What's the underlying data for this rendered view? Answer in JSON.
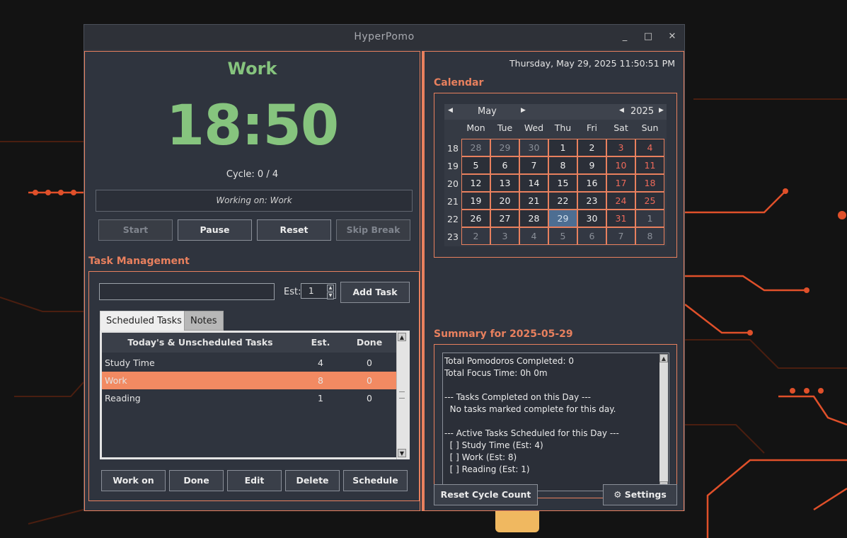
{
  "window": {
    "title": "HyperPomo"
  },
  "timer": {
    "mode": "Work",
    "time": "18:50",
    "cycle": "Cycle: 0 / 4",
    "working_on": "Working on: Work",
    "buttons": {
      "start": "Start",
      "pause": "Pause",
      "reset": "Reset",
      "skip": "Skip Break"
    }
  },
  "tasks": {
    "section_title": "Task Management",
    "input_value": "",
    "est_label": "Est:",
    "est_value": "1",
    "add_label": "Add Task",
    "tabs": [
      "Scheduled Tasks",
      "Notes"
    ],
    "columns": [
      "Today's & Unscheduled Tasks",
      "Est.",
      "Done"
    ],
    "rows": [
      {
        "name": "Study Time",
        "est": "4",
        "done": "0"
      },
      {
        "name": "Work",
        "est": "8",
        "done": "0"
      },
      {
        "name": "Reading",
        "est": "1",
        "done": "0"
      }
    ],
    "actions": {
      "work_on": "Work on",
      "done": "Done",
      "edit": "Edit",
      "delete": "Delete",
      "schedule": "Schedule"
    }
  },
  "datetime": "Thursday, May 29, 2025  11:50:51 PM",
  "calendar": {
    "title": "Calendar",
    "month": "May",
    "year": "2025",
    "dow": [
      "Mon",
      "Tue",
      "Wed",
      "Thu",
      "Fri",
      "Sat",
      "Sun"
    ],
    "weeks": [
      {
        "num": "18",
        "days": [
          "28",
          "29",
          "30",
          "1",
          "2",
          "3",
          "4"
        ]
      },
      {
        "num": "19",
        "days": [
          "5",
          "6",
          "7",
          "8",
          "9",
          "10",
          "11"
        ]
      },
      {
        "num": "20",
        "days": [
          "12",
          "13",
          "14",
          "15",
          "16",
          "17",
          "18"
        ]
      },
      {
        "num": "21",
        "days": [
          "19",
          "20",
          "21",
          "22",
          "23",
          "24",
          "25"
        ]
      },
      {
        "num": "22",
        "days": [
          "26",
          "27",
          "28",
          "29",
          "30",
          "31",
          "1"
        ]
      },
      {
        "num": "23",
        "days": [
          "2",
          "3",
          "4",
          "5",
          "6",
          "7",
          "8"
        ]
      }
    ]
  },
  "summary": {
    "title": "Summary for 2025-05-29",
    "lines": [
      "Total Pomodoros Completed: 0",
      "Total Focus Time: 0h 0m",
      "",
      "--- Tasks Completed on this Day ---",
      "  No tasks marked complete for this day.",
      "",
      "--- Active Tasks Scheduled for this Day ---",
      "  [ ] Study Time (Est: 4)",
      "  [ ] Work (Est: 8)",
      "  [ ] Reading (Est: 1)"
    ]
  },
  "footer": {
    "reset_cycle": "Reset Cycle Count",
    "settings": "⚙ Settings"
  },
  "colors": {
    "accent": "#e8805e",
    "timer_green": "#86c47e",
    "selected_row": "#f28a62",
    "weekend": "#ef6a5a",
    "today": "#4d6e92"
  }
}
